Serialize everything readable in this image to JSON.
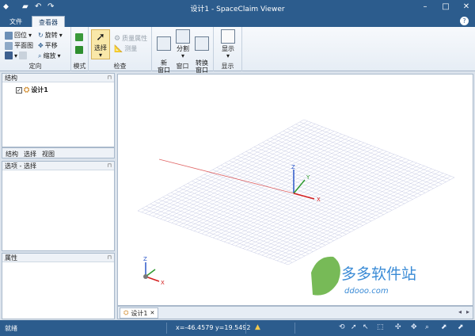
{
  "window": {
    "title": "设计1 - SpaceClaim Viewer",
    "app_icon": "spaceclaim-logo-icon",
    "quick_access": [
      "open-folder-icon",
      "undo-icon",
      "redo-icon"
    ],
    "controls": [
      "minimize-icon",
      "maximize-icon",
      "close-icon"
    ]
  },
  "tabs": [
    {
      "label": "文件",
      "active": false
    },
    {
      "label": "查看器",
      "active": true
    }
  ],
  "ribbon": {
    "orient_group": {
      "label": "定向",
      "home": "回位",
      "plan_view": "平面图",
      "spin": "旋转",
      "pan": "平移",
      "zoom": "缩放"
    },
    "mode_group": {
      "label": "模式"
    },
    "inspect_group": {
      "label": "检查",
      "select": "选择",
      "mass_properties": "质量属性",
      "measure": "测量"
    },
    "window_group": {
      "label": "窗口",
      "new_window": "新\n窗口",
      "split": "分割",
      "switch_window": "转换\n窗口"
    },
    "display_group": {
      "label": "显示",
      "display": "显示"
    }
  },
  "structure_panel": {
    "title": "结构",
    "tree_item": "设计1",
    "tabs": [
      "结构",
      "选择",
      "视图"
    ]
  },
  "options_panel": {
    "title": "选项 - 选择"
  },
  "properties_panel": {
    "title": "属性"
  },
  "viewport": {
    "axis_labels": {
      "x": "X",
      "y": "Y",
      "z": "Z"
    },
    "watermark_text": "多多软件站",
    "watermark_url": "ddooo.com"
  },
  "document_tab": {
    "label": "设计1"
  },
  "status_bar": {
    "status": "就绪",
    "coords": "x=-46.4579  y=19.5492"
  }
}
